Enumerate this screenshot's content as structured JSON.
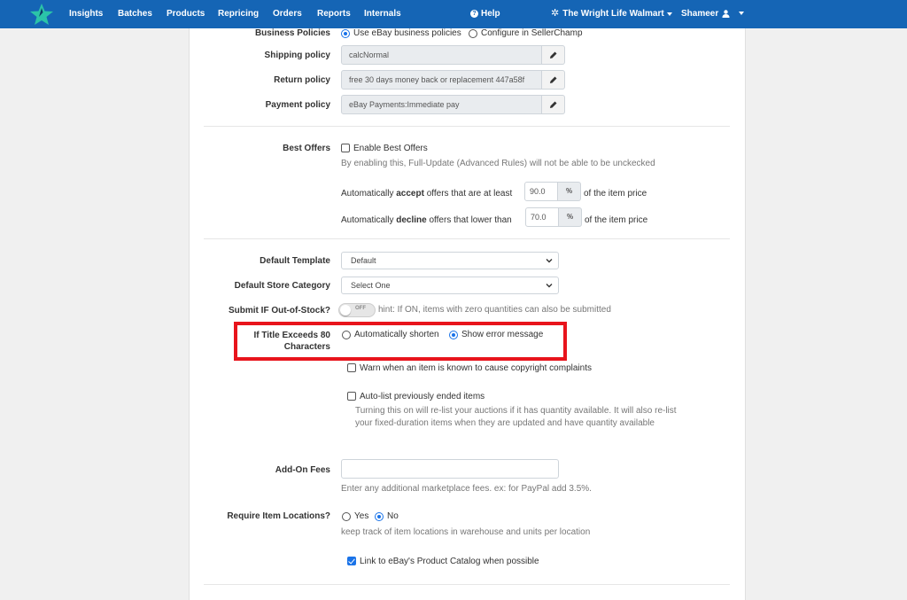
{
  "nav": {
    "items": [
      "Insights",
      "Batches",
      "Products",
      "Repricing",
      "Orders",
      "Reports",
      "Internals"
    ],
    "help": "Help",
    "store": "The Wright Life Walmart",
    "user": "Shameer"
  },
  "colors": {
    "navbar": "#1565b5",
    "accent": "#1a73e8",
    "highlight": "#e8141c"
  },
  "business_policies": {
    "label": "Business Policies",
    "option_ebay": "Use eBay business policies",
    "option_champ": "Configure in SellerChamp",
    "selected": "Use eBay business policies"
  },
  "shipping": {
    "label": "Shipping policy",
    "value": "calcNormal"
  },
  "return": {
    "label": "Return policy",
    "value": "free 30 days money back or replacement 447a58f"
  },
  "payment": {
    "label": "Payment policy",
    "value": "eBay Payments:Immediate pay"
  },
  "best_offers": {
    "label": "Best Offers",
    "checkbox": "Enable Best Offers",
    "checked": false,
    "hint": "By enabling this, Full-Update (Advanced Rules) will not be able to be unckecked",
    "accept_pre": "Automatically ",
    "accept_bold": "accept",
    "accept_post": " offers that are at least",
    "accept_value": "90.0",
    "decline_pre": "Automatically ",
    "decline_bold": "decline",
    "decline_post": " offers that lower than",
    "decline_value": "70.0",
    "unit": "%",
    "suffix": "of the item price"
  },
  "template": {
    "label": "Default Template",
    "value": "Default"
  },
  "store_category": {
    "label": "Default Store Category",
    "value": "Select One"
  },
  "out_of_stock": {
    "label": "Submit IF Out-of-Stock?",
    "toggle": "OFF",
    "hint": "hint: If ON, items with zero quantities can also be submitted"
  },
  "title_exceeds": {
    "label_line1": "If Title Exceeds 80",
    "label_line2": "Characters",
    "option_shorten": "Automatically shorten",
    "option_error": "Show error message",
    "selected": "Show error message"
  },
  "copyright": {
    "label": "Warn when an item is known to cause copyright complaints",
    "checked": false
  },
  "autolist": {
    "label": "Auto-list previously ended items",
    "checked": false,
    "hint": "Turning this on will re-list your auctions if it has quantity available. It will also re-list your fixed-duration items when they are updated and have quantity available"
  },
  "addon_fees": {
    "label": "Add-On Fees",
    "value": "",
    "hint": "Enter any additional marketplace fees. ex: for PayPal add 3.5%."
  },
  "item_locations": {
    "label": "Require Item Locations?",
    "yes": "Yes",
    "no": "No",
    "selected": "No",
    "hint": "keep track of item locations in warehouse and units per location"
  },
  "catalog": {
    "label": "Link to eBay's Product Catalog when possible",
    "checked": true
  }
}
